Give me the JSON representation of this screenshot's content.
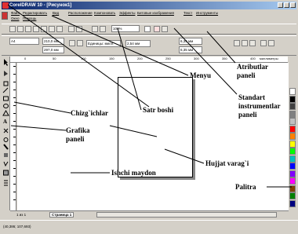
{
  "window": {
    "title": "CorelDRAW 10 - [Рисунок1]"
  },
  "menu": [
    "Файл",
    "Редактировать",
    "Вид",
    "Расположение",
    "Компоновать",
    "Эффекты",
    "Битовые изображения",
    "Текст",
    "Инструменты",
    "Окно",
    "Помощь"
  ],
  "toolbar": {
    "zoom": "100%",
    "paper": "A4",
    "width": "210,0 мм",
    "height": "297,0 мм",
    "units": "Единицы: милл.",
    "nudge": "2,54 мм",
    "dup_x": "6,35 мм",
    "dup_y": "6,35 мм"
  },
  "ruler": {
    "ticks": [
      "0",
      "50",
      "100",
      "150",
      "200",
      "250",
      "300",
      "350",
      "400"
    ],
    "units": "миллиметры"
  },
  "page_tabs": {
    "counter": "1 из 1",
    "tab": "Страница 1"
  },
  "status": {
    "coords": "(40,386; 107,693)"
  },
  "labels": {
    "menyu": "Menyu",
    "satr_boshi": "Satr boshi",
    "atributlar": "Atributlar\npaneli",
    "standart": "Standart\ninstrumentlar\npaneli",
    "chizgichlar": "Chizg`ichlar",
    "grafika": "Grafika\npaneli",
    "hujjat": "Hujjat varag`i",
    "ishchi": "Ishchi maydon",
    "palitra": "Palitra"
  },
  "colors": {
    "title_start": "#0a246a",
    "title_end": "#a6caf0",
    "chrome": "#d4d0c8"
  },
  "palette": [
    "#ffffff",
    "#000000",
    "#404040",
    "#808080",
    "#c0c0c0",
    "#ff0000",
    "#ff8000",
    "#ffff00",
    "#00ff00",
    "#00c0c0",
    "#0000ff",
    "#8000ff",
    "#ff00ff",
    "#804000",
    "#008000",
    "#000080"
  ]
}
